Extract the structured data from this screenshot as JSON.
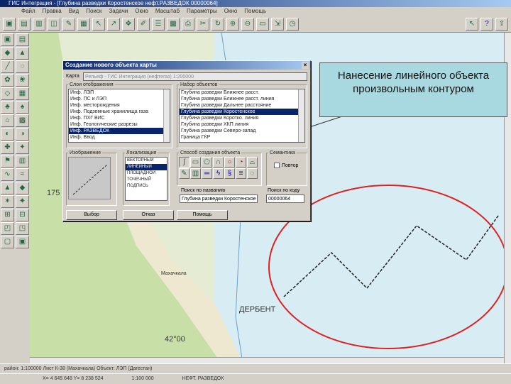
{
  "window": {
    "title": "ГИС Интеграция - [Глубина разведки Коростенское нефт.РАЗВЕДОК 00000064]"
  },
  "menu": [
    "Файл",
    "Правка",
    "Вид",
    "Поиск",
    "Задачи",
    "Окно",
    "Масштаб",
    "Параметры",
    "Окно",
    "Помощь"
  ],
  "dialog": {
    "title": "Создание нового объекта карты",
    "close": "×",
    "map_label": "Карта",
    "map_value": "Рельеф - ГИС Интеграция (нефтегаз) 1:200000",
    "layers_label": "Слои отображения",
    "layers": [
      "Инф. ЛЭП",
      "Инф. ПС и ЛЭП",
      "Инф. месторождения",
      "Инф. Подземные хранилища газа",
      "Инф. ПХГ ВИС",
      "Инф. Геологические разрезы",
      "Инф. РАЗВЕДОК",
      "Инф. Ввод"
    ],
    "layers_selected": 6,
    "objects_label": "Набор объектов",
    "objects": [
      "Глубина разведки Ближнее расст.",
      "Глубина разведки Ближнее расст. линия",
      "Глубина разведки Дальнее расстояние",
      "Глубина разведки Коростенское",
      "Глубина разведки Коротко. линия",
      "Глубина разведки ХКП линия",
      "Глубина разведки Северо-запад",
      "Граница ГКР"
    ],
    "objects_selected": 3,
    "image_label": "Изображение",
    "localization_label": "Локализация",
    "localizations": [
      "ВЕКТОРНЫЙ",
      "ЛИНЕЙНЫЙ",
      "ПЛОЩАДНОЙ",
      "ТОЧЕЧНЫЙ",
      "ПОДПИСЬ"
    ],
    "localization_selected": 1,
    "method_label": "Способ создания объекта",
    "methods": [
      "freehand-icon",
      "rectangle-icon",
      "polygon-icon",
      "curve-icon",
      "circle-icon",
      "circle-arrow-icon",
      "car-icon",
      "brush-icon",
      "hatch-icon",
      "parallel-icon",
      "zigzag-icon",
      "spiral-icon",
      "double-line-icon",
      "dotted-circle-icon"
    ],
    "semantics_label": "Семантика",
    "repeat_label": "Повтор",
    "search_name_label": "Поиск по названию",
    "search_name_value": "Глубина разведки Коростенское",
    "search_code_label": "Поиск по коду",
    "search_code_value": "00000064",
    "ok": "Выбор",
    "cancel": "Отказ",
    "help": "Помощь"
  },
  "callout": "Нанесение линейного объекта произвольным контуром",
  "map": {
    "labels": {
      "city": "ДЕРБЕНТ",
      "lat": "42°00",
      "num": "175",
      "town": "Махачкала"
    }
  },
  "status": {
    "line1": "район: 1:100000 Лист К-38 (Махачкала) Объект: ЛЭП (Дагестан)",
    "line2a": "X= 4 645 648  Y= 8 238 524",
    "line2b": "1:100 000",
    "line2c": "НЕФТ. РАЗВЕДОК"
  },
  "colors": {
    "ellipse": "#e02020",
    "callout": "#a8d8e0",
    "selection": "#0a246a"
  }
}
